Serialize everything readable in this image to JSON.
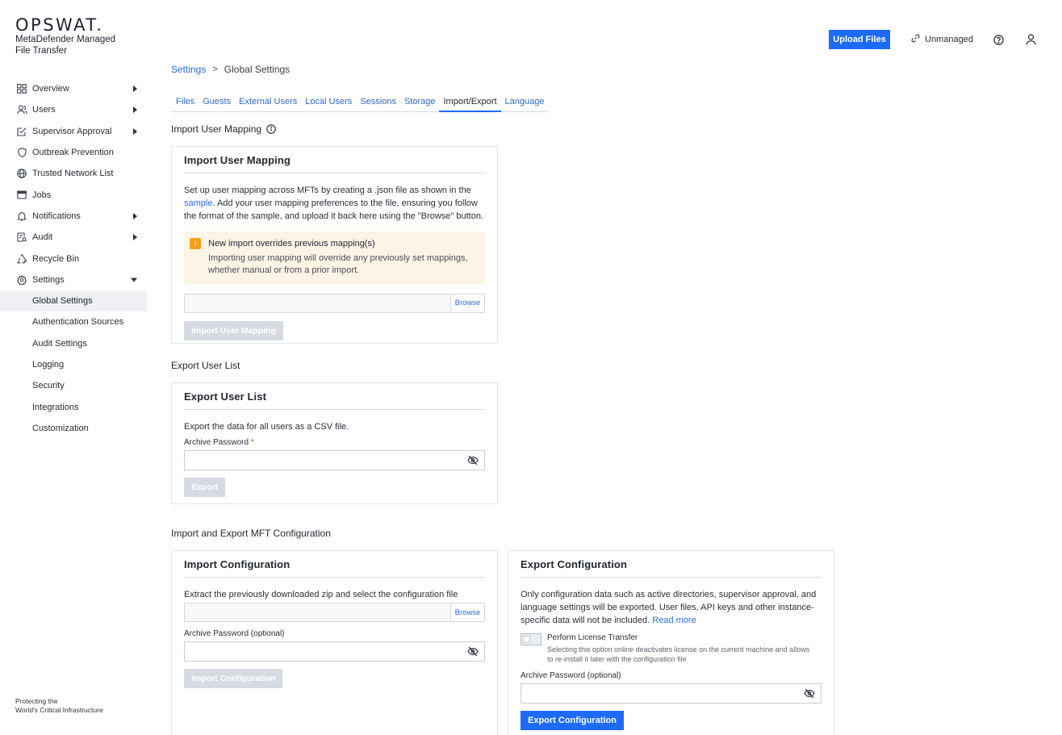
{
  "brand": {
    "name": "OPSWAT.",
    "product_line1": "MetaDefender Managed",
    "product_line2": "File Transfer",
    "footer_line1": "Protecting the",
    "footer_line2": "World's Critical Infrastructure"
  },
  "sidebar": {
    "items": [
      {
        "label": "Overview",
        "icon": "grid-icon",
        "caret": "right"
      },
      {
        "label": "Users",
        "icon": "users-icon",
        "caret": "right"
      },
      {
        "label": "Supervisor Approval",
        "icon": "approval-icon",
        "caret": "right"
      },
      {
        "label": "Outbreak Prevention",
        "icon": "shield-icon",
        "caret": ""
      },
      {
        "label": "Trusted Network List",
        "icon": "globe-icon",
        "caret": ""
      },
      {
        "label": "Jobs",
        "icon": "window-icon",
        "caret": ""
      },
      {
        "label": "Notifications",
        "icon": "bell-icon",
        "caret": "right"
      },
      {
        "label": "Audit",
        "icon": "audit-icon",
        "caret": "right"
      },
      {
        "label": "Recycle Bin",
        "icon": "recycle-icon",
        "caret": ""
      },
      {
        "label": "Settings",
        "icon": "gear-icon",
        "caret": "down"
      }
    ],
    "subitems": [
      "Global Settings",
      "Authentication Sources",
      "Audit Settings",
      "Logging",
      "Security",
      "Integrations",
      "Customization"
    ],
    "active_subitem": "Global Settings"
  },
  "topbar": {
    "upload_label": "Upload Files",
    "unmanaged_label": "Unmanaged"
  },
  "breadcrumb": {
    "root": "Settings",
    "sep": ">",
    "current": "Global Settings"
  },
  "tabs": [
    "Files",
    "Guests",
    "External Users",
    "Local Users",
    "Sessions",
    "Storage",
    "Import/Export",
    "Language"
  ],
  "active_tab": "Import/Export",
  "import_mapping": {
    "section_title": "Import User Mapping",
    "panel_title": "Import User Mapping",
    "desc_before_link": "Set up user mapping across MFTs by creating a .json file as shown in the",
    "desc_link": "sample",
    "desc_after_link": ". Add your user mapping preferences to the file, ensuring you follow the format of the sample, and upload it back here using the \"Browse\" button.",
    "warning_title": "New import overrides previous mapping(s)",
    "warning_text": "Importing user mapping will override any previously set mappings, whether manual or from a prior import.",
    "warning_icon_glyph": "!",
    "browse_label": "Browse",
    "button_label": "Import User Mapping"
  },
  "export_users": {
    "section_title": "Export User List",
    "panel_title": "Export User List",
    "desc": "Export the data for all users as a CSV file.",
    "password_label": "Archive Password",
    "required_mark": "*",
    "button_label": "Export"
  },
  "mft_config": {
    "section_title": "Import and Export MFT Configuration",
    "import": {
      "panel_title": "Import Configuration",
      "desc": "Extract the previously downloaded zip and select the configuration file",
      "browse_label": "Browse",
      "password_label": "Archive Password (optional)",
      "button_label": "Import Configuration"
    },
    "export": {
      "panel_title": "Export Configuration",
      "desc": "Only configuration data such as active directories, supervisor approval, and language settings will be exported. User files, API keys and other instance-specific data will not be included.",
      "read_more": "Read more",
      "toggle_label": "Perform License Transfer",
      "toggle_desc": "Selecting this option online deactivates license on the current machine and allows to re-install it later with the configuration file",
      "toggle_on": false,
      "password_label": "Archive Password (optional)",
      "button_label": "Export Configuration"
    }
  }
}
